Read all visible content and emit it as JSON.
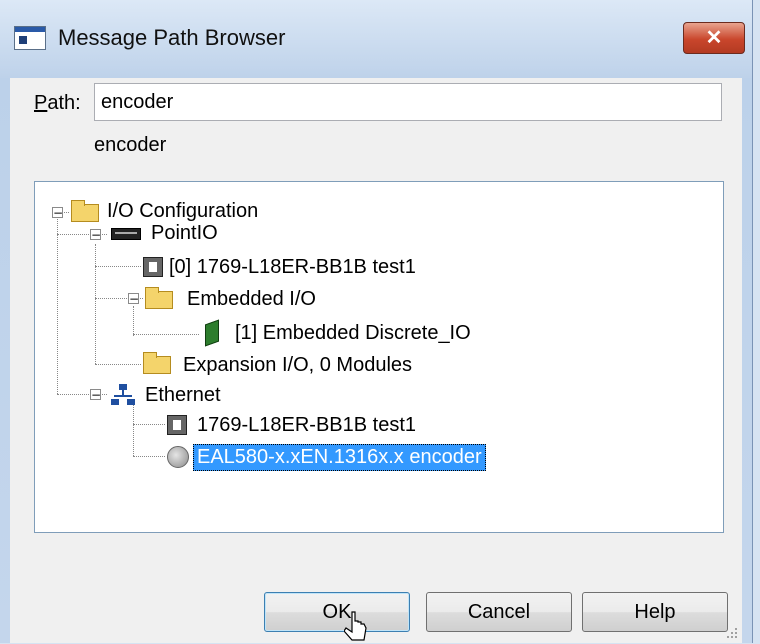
{
  "window": {
    "title": "Message Path Browser",
    "close_glyph": "✕"
  },
  "path": {
    "label_accel": "P",
    "label_rest": "ath:",
    "value": "encoder",
    "echo": "encoder"
  },
  "tree": {
    "nodes": {
      "io_config": "I/O Configuration",
      "pointio": "PointIO",
      "module0": "[0] 1769-L18ER-BB1B test1",
      "embedded_io": "Embedded I/O",
      "embedded_discrete": "[1] Embedded Discrete_IO",
      "expansion_io": "Expansion I/O, 0 Modules",
      "ethernet": "Ethernet",
      "eth_controller": "1769-L18ER-BB1B test1",
      "encoder": "EAL580-x.xEN.1316x.x encoder"
    },
    "selected": "encoder",
    "expander_minus": "−"
  },
  "buttons": {
    "ok": "OK",
    "cancel": "Cancel",
    "help": "Help"
  },
  "colors": {
    "selection": "#3399ff",
    "titlebar": "#bed2ea",
    "close": "#c9462c"
  }
}
